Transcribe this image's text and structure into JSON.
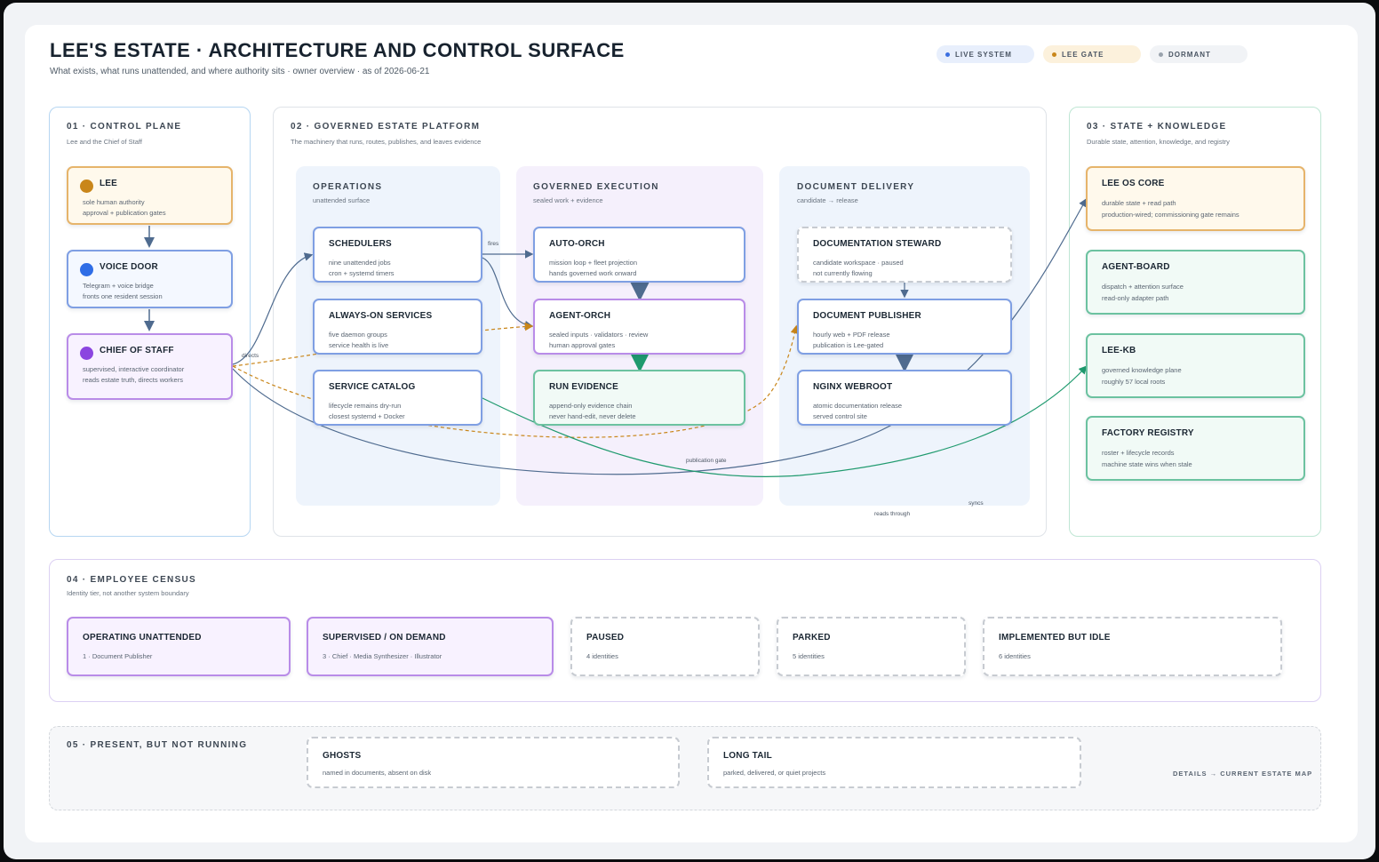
{
  "header": {
    "title": "LEE'S ESTATE · ARCHITECTURE AND CONTROL SURFACE",
    "subtitle": "What exists, what runs unattended, and where authority sits · owner overview · as of 2026-06-21"
  },
  "legend": [
    {
      "label": "LIVE SYSTEM",
      "color": "#3b6fe0"
    },
    {
      "label": "LEE GATE",
      "color": "#c9861a"
    },
    {
      "label": "DORMANT",
      "color": "#9aa3ad"
    }
  ],
  "sections": {
    "control_plane": {
      "label": "01 · CONTROL PLANE",
      "sub": "Lee and the Chief of Staff",
      "cards": {
        "lee": {
          "title": "LEE",
          "line1": "sole human authority",
          "line2": "approval + publication gates",
          "dot": "#c9861a"
        },
        "voice_door": {
          "title": "VOICE DOOR",
          "line1": "Telegram + voice bridge",
          "line2": "fronts one resident session",
          "dot": "#2f6de6"
        },
        "chief": {
          "title": "CHIEF OF STAFF",
          "line1": "supervised, interactive coordinator",
          "line2": "reads estate truth, directs workers",
          "dot": "#8b45e0"
        }
      }
    },
    "platform": {
      "label": "02 · GOVERNED ESTATE PLATFORM",
      "sub": "The machinery that runs, routes, publishes, and leaves evidence",
      "operations": {
        "label": "OPERATIONS",
        "sub": "unattended surface",
        "schedulers": {
          "title": "SCHEDULERS",
          "line1": "nine unattended jobs",
          "line2": "cron + systemd timers"
        },
        "always_on": {
          "title": "ALWAYS-ON SERVICES",
          "line1": "five daemon groups",
          "line2": "service health is live"
        },
        "catalog": {
          "title": "SERVICE CATALOG",
          "line1": "lifecycle remains dry-run",
          "line2": "closest systemd + Docker"
        }
      },
      "execution": {
        "label": "GOVERNED EXECUTION",
        "sub": "sealed work + evidence",
        "auto_orch": {
          "title": "AUTO-ORCH",
          "line1": "mission loop + fleet projection",
          "line2": "hands governed work onward"
        },
        "agent_orch": {
          "title": "AGENT-ORCH",
          "line1": "sealed inputs · validators · review",
          "line2": "human approval gates"
        },
        "run_evidence": {
          "title": "RUN EVIDENCE",
          "line1": "append-only evidence chain",
          "line2": "never hand-edit, never delete"
        }
      },
      "delivery": {
        "label": "DOCUMENT DELIVERY",
        "sub": "candidate → release",
        "steward": {
          "title": "DOCUMENTATION STEWARD",
          "line1": "candidate workspace · paused",
          "line2": "not currently flowing"
        },
        "publisher": {
          "title": "DOCUMENT PUBLISHER",
          "line1": "hourly web + PDF release",
          "line2": "publication is Lee-gated"
        },
        "nginx": {
          "title": "NGINX WEBROOT",
          "line1": "atomic documentation release",
          "line2": "served control site"
        }
      }
    },
    "state": {
      "label": "03 · STATE + KNOWLEDGE",
      "sub": "Durable state, attention, knowledge, and registry",
      "os_core": {
        "title": "LEE OS CORE",
        "line1": "durable state + read path",
        "line2": "production-wired; commissioning gate remains"
      },
      "agent_board": {
        "title": "AGENT-BOARD",
        "line1": "dispatch + attention surface",
        "line2": "read-only adapter path"
      },
      "lee_kb": {
        "title": "LEE-KB",
        "line1": "governed knowledge plane",
        "line2": "roughly 57 local roots"
      },
      "factory": {
        "title": "FACTORY REGISTRY",
        "line1": "roster + lifecycle records",
        "line2": "machine state wins when stale"
      }
    },
    "census": {
      "label": "04 · EMPLOYEE CENSUS",
      "sub": "Identity tier, not another system boundary",
      "cards": [
        {
          "title": "OPERATING UNATTENDED",
          "line": "1 · Document Publisher"
        },
        {
          "title": "SUPERVISED / ON DEMAND",
          "line": "3 · Chief · Media Synthesizer · Illustrator"
        },
        {
          "title": "PAUSED",
          "line": "4 identities"
        },
        {
          "title": "PARKED",
          "line": "5 identities"
        },
        {
          "title": "IMPLEMENTED BUT IDLE",
          "line": "6 identities"
        }
      ]
    },
    "not_running": {
      "label": "05 · PRESENT, BUT NOT RUNNING",
      "ghosts": {
        "title": "GHOSTS",
        "line": "named in documents, absent on disk"
      },
      "long_tail": {
        "title": "LONG TAIL",
        "line": "parked, delivered, or quiet projects"
      },
      "details_link": "DETAILS → CURRENT ESTATE MAP"
    }
  },
  "edge_labels": {
    "directs": "directs",
    "fires": "fires",
    "publication_gate": "publication gate",
    "reads_through": "reads through",
    "syncs": "syncs"
  },
  "colors": {
    "live_border": "#7f9fe3",
    "lee_gate": "#c9861a",
    "evidence_green": "#1f9a6e",
    "chief_purple": "#8b45e0",
    "connector": "#4f6b8f"
  }
}
